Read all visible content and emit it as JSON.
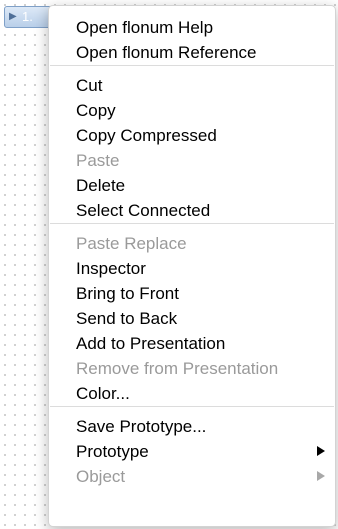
{
  "canvas_object": {
    "icon": "triangle-right-icon",
    "label": "1."
  },
  "context_menu": {
    "groups": [
      [
        {
          "label": "Open flonum Help",
          "enabled": true
        },
        {
          "label": "Open flonum Reference",
          "enabled": true
        }
      ],
      [
        {
          "label": "Cut",
          "enabled": true
        },
        {
          "label": "Copy",
          "enabled": true
        },
        {
          "label": "Copy Compressed",
          "enabled": true
        },
        {
          "label": "Paste",
          "enabled": false
        },
        {
          "label": "Delete",
          "enabled": true
        },
        {
          "label": "Select Connected",
          "enabled": true
        }
      ],
      [
        {
          "label": "Paste Replace",
          "enabled": false
        },
        {
          "label": "Inspector",
          "enabled": true
        },
        {
          "label": "Bring to Front",
          "enabled": true
        },
        {
          "label": "Send to Back",
          "enabled": true
        },
        {
          "label": "Add to Presentation",
          "enabled": true
        },
        {
          "label": "Remove from Presentation",
          "enabled": false
        },
        {
          "label": "Color...",
          "enabled": true
        }
      ],
      [
        {
          "label": "Save Prototype...",
          "enabled": true
        },
        {
          "label": "Prototype",
          "enabled": true,
          "submenu": true
        },
        {
          "label": "Object",
          "enabled": false,
          "submenu": true
        }
      ]
    ]
  }
}
